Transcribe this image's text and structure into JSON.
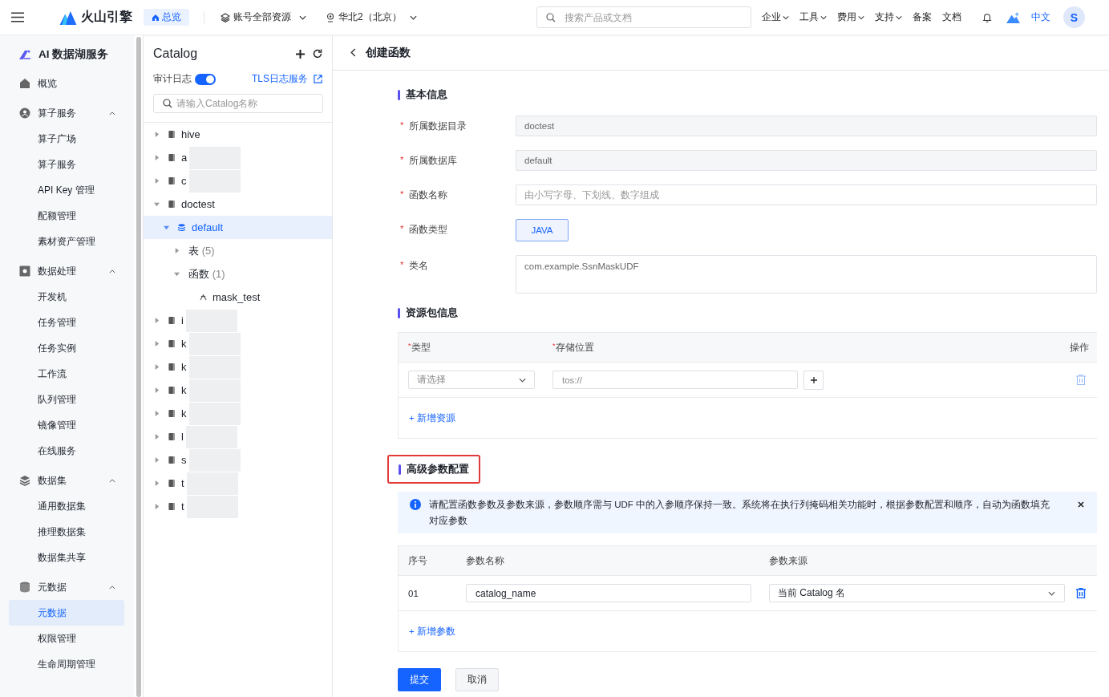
{
  "topbar": {
    "brand": "火山引擎",
    "home": "总览",
    "scope": "账号全部资源",
    "region": "华北2（北京）",
    "search": {
      "placeholder": "搜索产品或文档"
    },
    "menus": [
      {
        "label": "企业",
        "dropdown": true
      },
      {
        "label": "工具",
        "dropdown": true
      },
      {
        "label": "费用",
        "dropdown": true
      },
      {
        "label": "支持",
        "dropdown": true
      },
      {
        "label": "备案",
        "dropdown": false
      },
      {
        "label": "文档",
        "dropdown": false
      }
    ],
    "language": "中文",
    "avatar": "S"
  },
  "sidebar": {
    "title": "AI 数据湖服务",
    "items": [
      {
        "label": "概览",
        "kind": "link"
      },
      {
        "label": "算子服务",
        "kind": "group",
        "expanded": true,
        "children": [
          {
            "label": "算子广场",
            "selected": false
          },
          {
            "label": "算子服务",
            "selected": false
          },
          {
            "label": "API Key 管理",
            "selected": false
          },
          {
            "label": "配额管理",
            "selected": false
          },
          {
            "label": "素材资产管理",
            "selected": false
          }
        ]
      },
      {
        "label": "数据处理",
        "kind": "group",
        "expanded": true,
        "children": [
          {
            "label": "开发机",
            "selected": false
          },
          {
            "label": "任务管理",
            "selected": false
          },
          {
            "label": "任务实例",
            "selected": false
          },
          {
            "label": "工作流",
            "selected": false
          },
          {
            "label": "队列管理",
            "selected": false
          },
          {
            "label": "镜像管理",
            "selected": false
          },
          {
            "label": "在线服务",
            "selected": false
          }
        ]
      },
      {
        "label": "数据集",
        "kind": "group",
        "expanded": true,
        "children": [
          {
            "label": "通用数据集",
            "selected": false
          },
          {
            "label": "推理数据集",
            "selected": false
          },
          {
            "label": "数据集共享",
            "selected": false
          }
        ]
      },
      {
        "label": "元数据",
        "kind": "group",
        "expanded": true,
        "children": [
          {
            "label": "元数据",
            "selected": true
          },
          {
            "label": "权限管理",
            "selected": false
          },
          {
            "label": "生命周期管理",
            "selected": false
          }
        ]
      }
    ]
  },
  "catalog": {
    "title": "Catalog",
    "audit_label": "审计日志",
    "audit_on": true,
    "tls_link": "TLS日志服务",
    "search": {
      "placeholder": "请输入Catalog名称"
    },
    "tree": [
      {
        "name": "hive",
        "kind": "catalog",
        "expanded": false,
        "redacted": false
      },
      {
        "name": "a",
        "kind": "catalog",
        "expanded": false,
        "redacted": true
      },
      {
        "name": "c",
        "kind": "catalog",
        "expanded": false,
        "redacted": true
      },
      {
        "name": "doctest",
        "kind": "catalog",
        "expanded": true,
        "redacted": false,
        "children": [
          {
            "name": "default",
            "kind": "database",
            "expanded": true,
            "selected": true,
            "children": [
              {
                "name": "表",
                "count": "(5)",
                "expanded": false
              },
              {
                "name": "函数",
                "count": "(1)",
                "expanded": true,
                "children": [
                  {
                    "name": "mask_test",
                    "kind": "function"
                  }
                ]
              }
            ]
          }
        ]
      },
      {
        "name": "i",
        "kind": "catalog",
        "expanded": false,
        "redacted": true
      },
      {
        "name": "k",
        "kind": "catalog",
        "expanded": false,
        "redacted": true
      },
      {
        "name": "k",
        "kind": "catalog",
        "expanded": false,
        "redacted": true
      },
      {
        "name": "k",
        "kind": "catalog",
        "expanded": false,
        "redacted": true
      },
      {
        "name": "k",
        "kind": "catalog",
        "expanded": false,
        "redacted": true
      },
      {
        "name": "l",
        "kind": "catalog",
        "expanded": false,
        "redacted": true
      },
      {
        "name": "s",
        "kind": "catalog",
        "expanded": false,
        "redacted": true
      },
      {
        "name": "t",
        "kind": "catalog",
        "expanded": false,
        "redacted": true
      },
      {
        "name": "t",
        "kind": "catalog",
        "expanded": false,
        "redacted": true
      }
    ]
  },
  "page": {
    "title": "创建函数",
    "basic": {
      "title": "基本信息",
      "fields": [
        {
          "mark": "*",
          "label": "所属数据目录",
          "kind": "readonly",
          "value": "doctest"
        },
        {
          "mark": "*",
          "label": "所属数据库",
          "kind": "readonly",
          "value": "default"
        },
        {
          "mark": "*",
          "label": "函数名称",
          "kind": "input",
          "placeholder": "由小写字母、下划线、数字组成"
        },
        {
          "mark": "*",
          "label": "函数类型",
          "kind": "choice",
          "value": "JAVA"
        },
        {
          "mark": "*",
          "label": "类名",
          "kind": "textarea",
          "value": "com.example.SsnMaskUDF"
        }
      ]
    },
    "resources": {
      "title": "资源包信息",
      "columns": [
        {
          "mark": "*",
          "label": "类型"
        },
        {
          "mark": "*",
          "label": "存储位置"
        },
        {
          "label": "操作"
        }
      ],
      "row": {
        "type": {
          "placeholder": "请选择"
        },
        "location": "tos://"
      },
      "add": "+ 新增资源"
    },
    "advanced": {
      "title": "高级参数配置",
      "highlighted": true,
      "notice": "请配置函数参数及参数来源，参数顺序需与 UDF 中的入参顺序保持一致。系统将在执行列掩码相关功能时，根据参数配置和顺序，自动为函数填充对应参数",
      "columns": [
        "序号",
        "参数名称",
        "参数来源"
      ],
      "rows": [
        {
          "index": "01",
          "name": "catalog_name",
          "source": "当前 Catalog 名"
        }
      ],
      "add": "+ 新增参数"
    },
    "submit": "提交",
    "cancel": "取消"
  }
}
